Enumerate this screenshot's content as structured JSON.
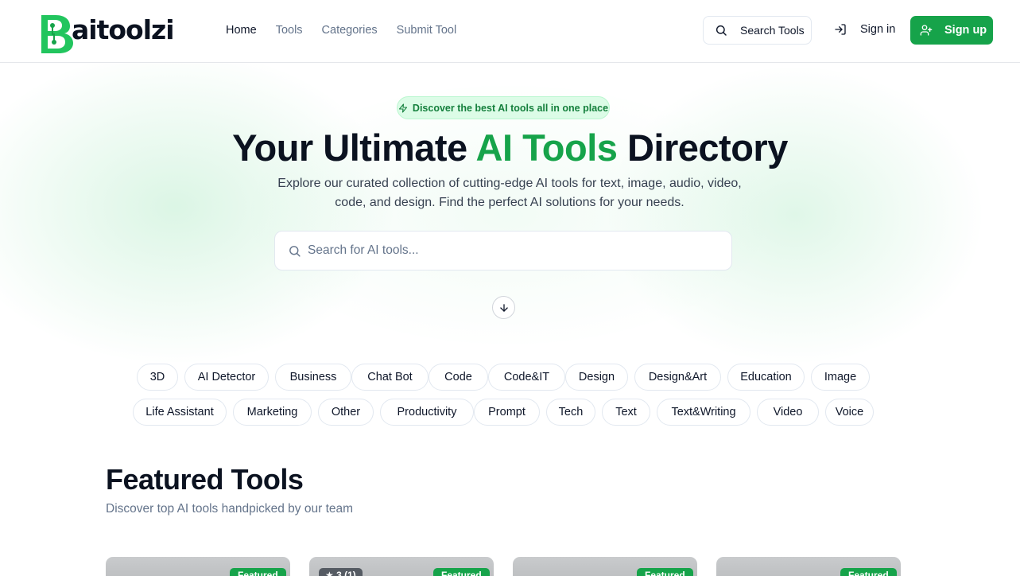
{
  "brand": {
    "name": "aitoolzi",
    "logo_letter": "B",
    "accent": "#16a34a"
  },
  "nav": {
    "items": [
      {
        "label": "Home",
        "active": true
      },
      {
        "label": "Tools",
        "active": false
      },
      {
        "label": "Categories",
        "active": false
      },
      {
        "label": "Submit Tool",
        "active": false
      }
    ]
  },
  "header": {
    "search_label": "Search Tools",
    "signin_label": "Sign in",
    "signup_label": "Sign up"
  },
  "hero": {
    "badge": "Discover the best AI tools all in one place",
    "title_pre": "Your Ultimate ",
    "title_accent": "AI Tools",
    "title_post": " Directory",
    "subtitle": "Explore our curated collection of cutting-edge AI tools for text, image, audio, video, code, and design. Find the perfect AI solutions for your needs.",
    "search_placeholder": "Search for AI tools..."
  },
  "categories": [
    "3D",
    "AI Detector",
    "Business",
    "Chat Bot",
    "Code",
    "Code&IT",
    "Design",
    "Design&Art",
    "Education",
    "Image",
    "Life Assistant",
    "Marketing",
    "Other",
    "Productivity",
    "Prompt",
    "Tech",
    "Text",
    "Text&Writing",
    "Video",
    "Voice"
  ],
  "featured": {
    "title": "Featured Tools",
    "subtitle": "Discover top AI tools handpicked by our team",
    "cards": [
      {
        "badge": "Featured",
        "rating": ""
      },
      {
        "badge": "Featured",
        "rating": "★ 3 (1)"
      },
      {
        "badge": "Featured",
        "rating": ""
      },
      {
        "badge": "Featured",
        "rating": ""
      }
    ]
  },
  "icons": {
    "search": "search-icon",
    "signin": "login-arrow-icon",
    "signup": "user-plus-icon",
    "badge": "lightning-icon",
    "scroll": "arrow-down-icon"
  }
}
